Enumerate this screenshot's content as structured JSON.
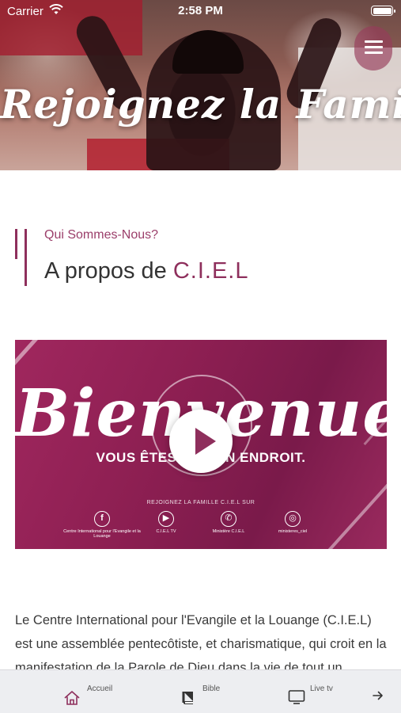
{
  "status_bar": {
    "carrier": "Carrier",
    "time": "2:58 PM"
  },
  "hero": {
    "title": "Rejoignez la Famille"
  },
  "section": {
    "eyebrow": "Qui Sommes-Nous?",
    "title_prefix": "A propos de ",
    "title_brand": "C.I.E.L"
  },
  "video": {
    "script_text": "Bienvenue",
    "subtitle": "VOUS ÊTES AU BON ENDROIT.",
    "join_text": "REJOIGNEZ LA FAMILLE C.I.E.L SUR",
    "socials": [
      {
        "icon": "facebook-icon",
        "glyph": "f",
        "label": "Centre International pour l'Evangile et la Louange"
      },
      {
        "icon": "youtube-icon",
        "glyph": "▶",
        "label": "C.I.E.L TV"
      },
      {
        "icon": "whatsapp-icon",
        "glyph": "✆",
        "label": "Ministère C.I.E.L"
      },
      {
        "icon": "instagram-icon",
        "glyph": "◎",
        "label": "ministeres_ciel"
      }
    ]
  },
  "body": {
    "paragraph": "Le Centre International pour l'Evangile et la Louange (C.I.E.L) est une assemblée pentecôtiste, et charismatique, qui croit en la manifestation de la Parole de Dieu dans la vie de tout un"
  },
  "tabbar": {
    "items": [
      {
        "label": "Accueil",
        "icon": "home-icon"
      },
      {
        "label": "Bible",
        "icon": "bible-icon"
      },
      {
        "label": "Live tv",
        "icon": "tv-icon"
      }
    ],
    "more_icon": "arrow-right-icon"
  },
  "colors": {
    "accent": "#8e2f5c",
    "video_bg": "#8d1f52",
    "tabbar_bg": "#edeef1"
  }
}
